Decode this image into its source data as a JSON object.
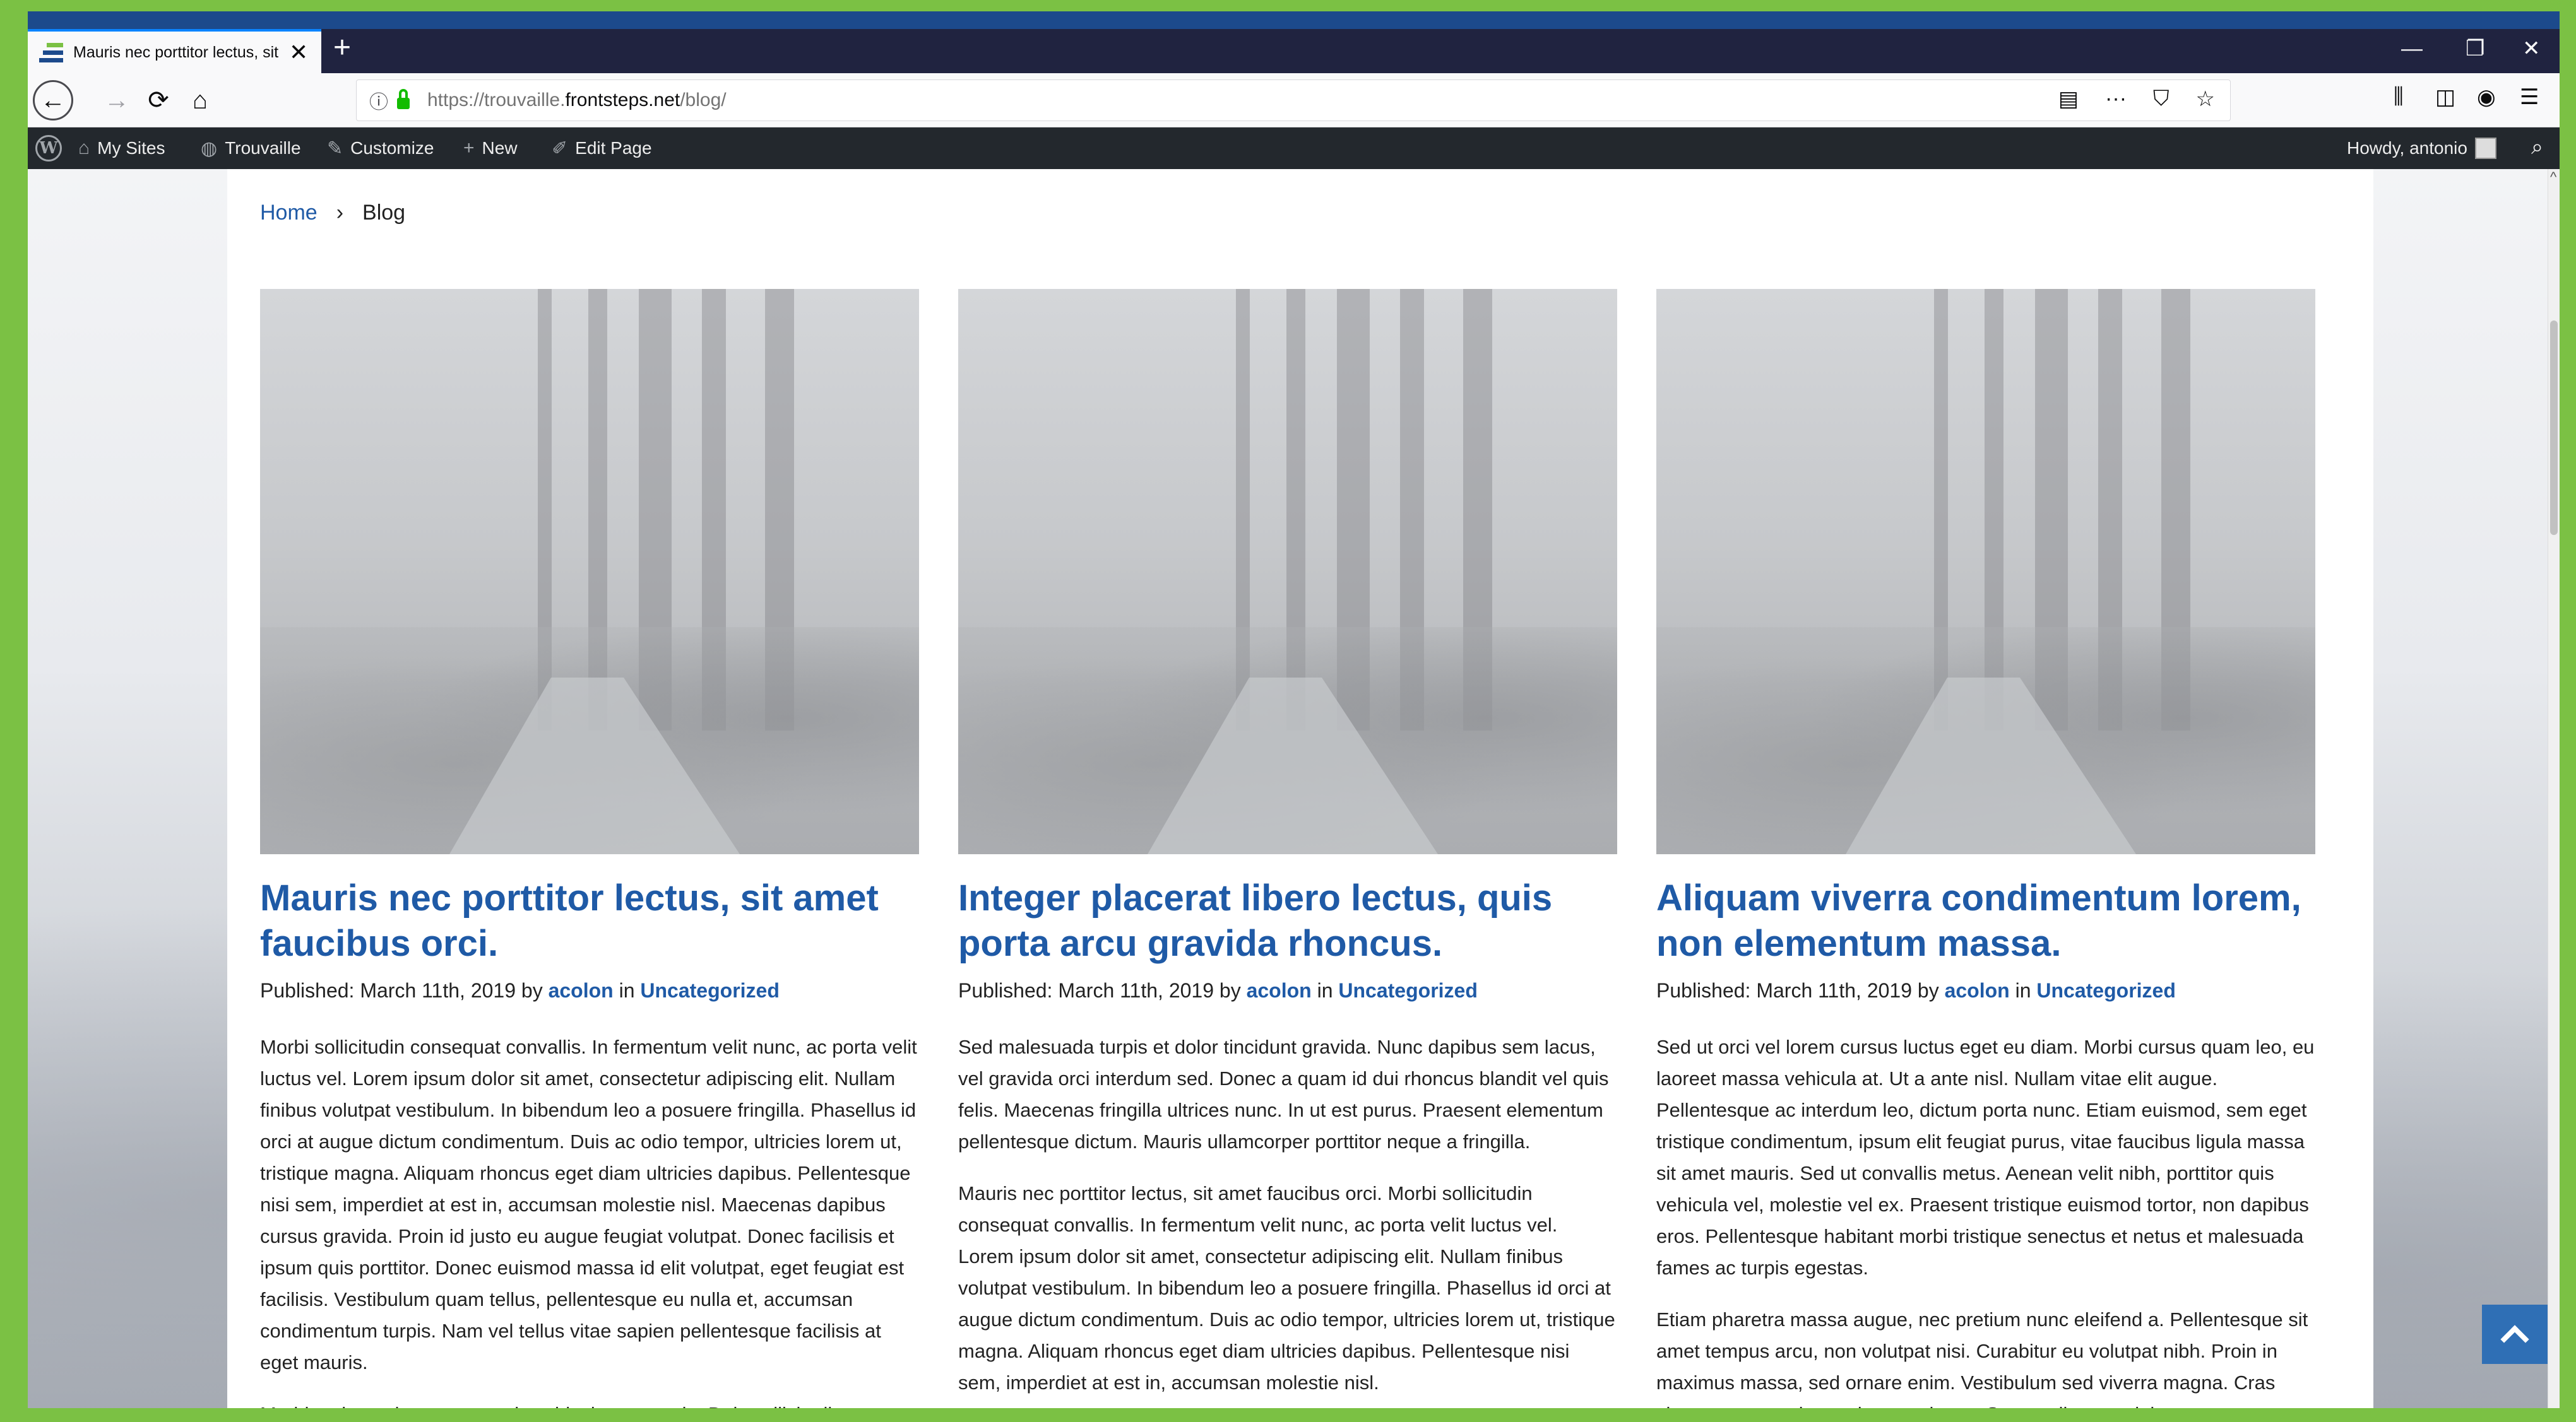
{
  "browser": {
    "tab_title": "Mauris nec porttitor lectus, sit amet faucibus orci.",
    "tab_close": "✕",
    "new_tab": "+",
    "window_controls": {
      "minimize": "—",
      "restore": "❐",
      "close": "✕"
    },
    "url": {
      "prefix": "https://trouvaille.",
      "domain": "frontsteps.net",
      "path": "/blog/"
    },
    "nav_icons": {
      "back": "←",
      "forward": "→",
      "reload": "⟳",
      "home": "⌂"
    },
    "url_icons": {
      "info": "ⓘ",
      "reader": "▤",
      "more": "···",
      "pocket": "⛉",
      "bookmark": "☆"
    },
    "toolbar_icons": {
      "library": "⫼",
      "sidebar": "◫",
      "account": "◉",
      "menu": "☰"
    }
  },
  "adminbar": {
    "wp_logo": "W",
    "my_sites": "My Sites",
    "site_name": "Trouvaille",
    "customize": "Customize",
    "new": "New",
    "edit_page": "Edit Page",
    "howdy": "Howdy, antonio",
    "icons": {
      "my_sites": "⌂",
      "site": "◍",
      "customize": "✎",
      "new": "+",
      "edit": "✐",
      "search": "⌕"
    }
  },
  "breadcrumb": {
    "home": "Home",
    "separator": "›",
    "current": "Blog"
  },
  "meta_labels": {
    "published": "Published:",
    "by": "by",
    "in": "in"
  },
  "posts": [
    {
      "title": "Mauris nec porttitor lectus, sit amet faucibus orci.",
      "date": "March 11th, 2019",
      "author": "acolon",
      "category": "Uncategorized",
      "paragraphs": [
        "Morbi sollicitudin consequat convallis. In fermentum velit nunc, ac porta velit luctus vel. Lorem ipsum dolor sit amet, consectetur adipiscing elit. Nullam finibus volutpat vestibulum. In bibendum leo a posuere fringilla. Phasellus id orci at augue dictum condimentum. Duis ac odio tempor, ultricies lorem ut, tristique magna. Aliquam rhoncus eget diam ultricies dapibus. Pellentesque nisi sem, imperdiet at est in, accumsan molestie nisl. Maecenas dapibus cursus gravida. Proin id justo eu augue feugiat volutpat. Donec facilisis et ipsum quis porttitor. Donec euismod massa id elit volutpat, eget feugiat est facilisis. Vestibulum quam tellus, pellentesque eu nulla et, accumsan condimentum turpis. Nam vel tellus vitae sapien pellentesque facilisis at eget mauris.",
        "Morbi malesuada ante et turpis vehicula commodo. Duis sollicitudin"
      ]
    },
    {
      "title": "Integer placerat libero lectus, quis porta arcu gravida rhoncus.",
      "date": "March 11th, 2019",
      "author": "acolon",
      "category": "Uncategorized",
      "paragraphs": [
        "Sed malesuada turpis et dolor tincidunt gravida. Nunc dapibus sem lacus, vel gravida orci interdum sed. Donec a quam id dui rhoncus blandit vel quis felis. Maecenas fringilla ultrices nunc. In ut est purus. Praesent elementum pellentesque dictum. Mauris ullamcorper porttitor neque a fringilla.",
        "Mauris nec porttitor lectus, sit amet faucibus orci. Morbi sollicitudin consequat convallis. In fermentum velit nunc, ac porta velit luctus vel. Lorem ipsum dolor sit amet, consectetur adipiscing elit. Nullam finibus volutpat vestibulum. In bibendum leo a posuere fringilla. Phasellus id orci at augue dictum condimentum. Duis ac odio tempor, ultricies lorem ut, tristique magna. Aliquam rhoncus eget diam ultricies dapibus. Pellentesque nisi sem, imperdiet at est in, accumsan molestie nisl."
      ]
    },
    {
      "title": "Aliquam viverra condimentum lorem, non elementum massa.",
      "date": "March 11th, 2019",
      "author": "acolon",
      "category": "Uncategorized",
      "paragraphs": [
        "Sed ut orci vel lorem cursus luctus eget eu diam. Morbi cursus quam leo, eu laoreet massa vehicula at. Ut a ante nisl. Nullam vitae elit augue. Pellentesque ac interdum leo, dictum porta nunc. Etiam euismod, sem eget tristique condimentum, ipsum elit feugiat purus, vitae faucibus ligula massa sit amet mauris. Sed ut convallis metus. Aenean velit nibh, porttitor quis vehicula vel, molestie vel ex. Praesent tristique euismod tortor, non dapibus eros. Pellentesque habitant morbi tristique senectus et netus et malesuada fames ac turpis egestas.",
        "Etiam pharetra massa augue, nec pretium nunc eleifend a. Pellentesque sit amet tempus arcu, non volutpat nisi. Curabitur eu volutpat nibh. Proin in maximus massa, sed ornare enim. Vestibulum sed viverra magna. Cras vitae egestas enim, sed ornare lacus. Suspendisse sagittis"
      ]
    }
  ],
  "colors": {
    "link": "#1f5aa6",
    "frame_green": "#7bc144",
    "frame_blue": "#1c4a8c",
    "back_to_top": "#2f6fb5"
  }
}
